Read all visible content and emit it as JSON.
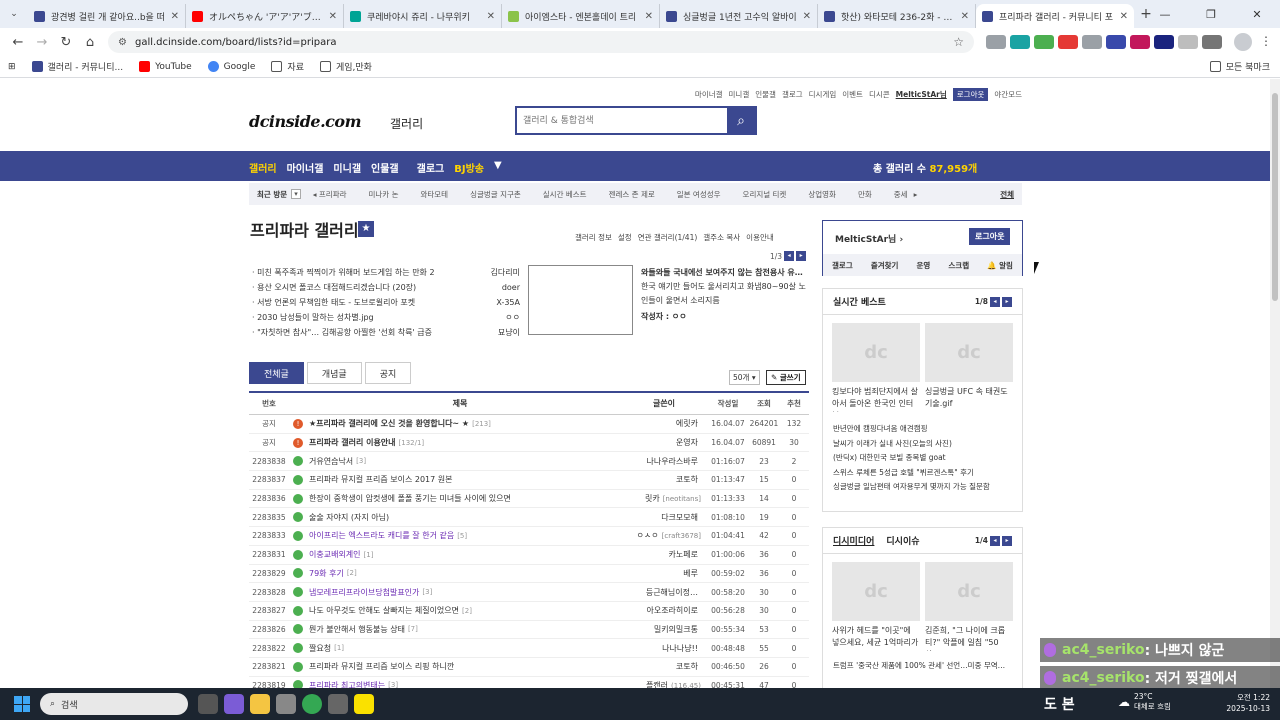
{
  "browser": {
    "tabs": [
      {
        "title": "광견병 걸린 개 같아요..b을 떠",
        "color": "#3b4890",
        "active": false
      },
      {
        "title": "オルペちゃん 'ア'ア'ア'ブロキシ動",
        "color": "#ff0000",
        "active": false
      },
      {
        "title": "쿠레바야시 쥬리 - 나무위키",
        "color": "#00a495",
        "active": false
      },
      {
        "title": "아이엠스타 - 엔본홀데이 트리",
        "color": "#8bc34a",
        "active": false
      },
      {
        "title": "싱글벙글 1년전 고수익 알바이",
        "color": "#3b4890",
        "active": false
      },
      {
        "title": "핫산) 와타모테 236-2화 - 와타",
        "color": "#3b4890",
        "active": false
      },
      {
        "title": "프리파라 갤러리 - 커뮤니티 포",
        "color": "#3b4890",
        "active": true
      }
    ],
    "url": "gall.dcinside.com/board/lists?id=pripara",
    "bookmarks": [
      "갤러리 - 커뮤니티...",
      "YouTube",
      "Google",
      "자료",
      "게임,만화"
    ],
    "bookmarks_right": "모든 북마크"
  },
  "site": {
    "toplinks": [
      "마이너갤",
      "미니갤",
      "인물갤",
      "갤로그",
      "디시게임",
      "이벤트",
      "디시콘"
    ],
    "user": "MelticStAr님",
    "logout": "로그아웃",
    "darkmode": "야간모드",
    "logo": "dcinside.com",
    "logo_sub": "갤러리",
    "search_placeholder": "갤러리 & 통합검색",
    "gnb": [
      "갤러리",
      "마이너갤",
      "미니갤",
      "인물갤",
      "갤로그",
      "BJ방송"
    ],
    "gallery_count_label": "총 갤러리 수",
    "gallery_count": "87,959개",
    "recent_label": "최근 방문",
    "recent": [
      "프리파라",
      "미나카 논",
      "와타모테",
      "싱글벙글 지구촌",
      "실시간 베스트",
      "젠레스 존 제로",
      "일본 여성성우",
      "오리지널 티켓",
      "상업영화",
      "만화",
      "중세"
    ],
    "recent_all": "전체"
  },
  "gallery": {
    "title": "프리파라 갤러리",
    "mark": "★",
    "options": [
      "갤러리 정보",
      "설정",
      "연관 갤러리(1/41)",
      "갤주소 복사",
      "이용안내"
    ],
    "page": "1/3",
    "issues": [
      {
        "title": "미친 폭주족과 찍찍이가 위해머 보드게임 하는 만화 2",
        "author": "김다리미"
      },
      {
        "title": "용산 오시면 폴코스 대접해드리겠습니다 (20장)",
        "author": "doer"
      },
      {
        "title": "서방 언론의 무책임한 태도 - 도브로윌리아 포켓",
        "author": "X-35A"
      },
      {
        "title": "2030 남성들이 말하는 성차별.jpg",
        "author": "ㅇㅇ"
      },
      {
        "title": "\"자칫하면 참사\"… 김해공항 아찔한 '선회 착륙' 급증",
        "author": "묘냥이"
      }
    ],
    "feature": {
      "title": "와들와들 국내에선 보여주지 않는 참전용사 유…",
      "desc": "한국 얘기만 들어도 울서리치고 화냄80~90살 노인들이 울면서 소리지름",
      "writer_label": "작성자 :",
      "writer": "ㅇㅇ"
    },
    "list_tabs": [
      "전체글",
      "개념글",
      "공지"
    ],
    "per_page": "50개 ▾",
    "write": "✎ 글쓰기",
    "columns": [
      "번호",
      "제목",
      "글쓴이",
      "작성일",
      "조회",
      "추천"
    ],
    "rows": [
      {
        "no": "공지",
        "icon": "notice",
        "title": "★프리파라 갤러리에 오신 것을 환영합니다~ ★",
        "comments": "[213]",
        "author": "에릿카",
        "nick": "",
        "date": "16.04.07",
        "views": "264201",
        "recs": "132",
        "style": "bold"
      },
      {
        "no": "공지",
        "icon": "notice",
        "title": "프리파라 갤러리 이용안내",
        "comments": "[132/1]",
        "author": "운영자",
        "nick": "",
        "date": "16.04.07",
        "views": "60891",
        "recs": "30",
        "style": "bold"
      },
      {
        "no": "2283838",
        "icon": "post",
        "title": "거유연습낙서",
        "comments": "[3]",
        "author": "나나우라스바루",
        "nick": "",
        "date": "01:16:07",
        "views": "23",
        "recs": "2",
        "style": ""
      },
      {
        "no": "2283837",
        "icon": "post",
        "title": "프리파라 뮤지컬 프리즘 보이스 2017 원본",
        "comments": "",
        "author": "코토하",
        "nick": "",
        "date": "01:13:47",
        "views": "15",
        "recs": "0",
        "style": ""
      },
      {
        "no": "2283836",
        "icon": "post",
        "title": "한장이 중학생이 압컷생에 폴폴 풍기는 미녀들 사이에 있으면",
        "comments": "",
        "author": "릿카",
        "nick": "[neotitans]",
        "date": "01:13:33",
        "views": "14",
        "recs": "0",
        "style": ""
      },
      {
        "no": "2283835",
        "icon": "post",
        "title": "술술 자야지 (자지 아님)",
        "comments": "",
        "author": "다크모모해",
        "nick": "",
        "date": "01:08:10",
        "views": "19",
        "recs": "0",
        "style": ""
      },
      {
        "no": "2283833",
        "icon": "post",
        "title": "아이프리는 엑스트라도 캐디를 잘 한거 같음",
        "comments": "[5]",
        "author": "ㅇㅅㅇ",
        "nick": "[craft3678]",
        "date": "01:04:41",
        "views": "42",
        "recs": "0",
        "style": "purple"
      },
      {
        "no": "2283831",
        "icon": "post",
        "title": "이충교배외계인",
        "comments": "[1]",
        "author": "카노페로",
        "nick": "",
        "date": "01:00:06",
        "views": "36",
        "recs": "0",
        "style": "purple"
      },
      {
        "no": "2283829",
        "icon": "post",
        "title": "79화 후기",
        "comments": "[2]",
        "author": "베루",
        "nick": "",
        "date": "00:59:02",
        "views": "36",
        "recs": "0",
        "style": "purple"
      },
      {
        "no": "2283828",
        "icon": "post",
        "title": "냄모레프리프라이브당첨발표인가",
        "comments": "[3]",
        "author": "등근해님이정…",
        "nick": "",
        "date": "00:58:20",
        "views": "30",
        "recs": "0",
        "style": "purple"
      },
      {
        "no": "2283827",
        "icon": "post",
        "title": "나도 아무것도 안해도 살빠지는 체질이었으면",
        "comments": "[2]",
        "author": "아오조라히이로",
        "nick": "",
        "date": "00:56:28",
        "views": "30",
        "recs": "0",
        "style": ""
      },
      {
        "no": "2283826",
        "icon": "post",
        "title": "뭔가 불안해서 행동불능 상태",
        "comments": "[7]",
        "author": "밀키의밀크통",
        "nick": "",
        "date": "00:55:34",
        "views": "53",
        "recs": "0",
        "style": ""
      },
      {
        "no": "2283822",
        "icon": "post",
        "title": "짤요청",
        "comments": "[1]",
        "author": "나나나냥!!",
        "nick": "",
        "date": "00:48:48",
        "views": "55",
        "recs": "0",
        "style": ""
      },
      {
        "no": "2283821",
        "icon": "post",
        "title": "프리파라 뮤지컬 프리즘 보이스 리핑 하니깐",
        "comments": "",
        "author": "코토하",
        "nick": "",
        "date": "00:46:50",
        "views": "26",
        "recs": "0",
        "style": ""
      },
      {
        "no": "2283819",
        "icon": "post",
        "title": "프리파라 최고의변태는",
        "comments": "[3]",
        "author": "플캔러",
        "nick": "(116.45)",
        "date": "00:45:31",
        "views": "47",
        "recs": "0",
        "style": "purple"
      }
    ]
  },
  "side": {
    "user": "MelticStAr님",
    "logout": "로그아웃",
    "menu": [
      "갤로그",
      "즐겨찾기",
      "운영",
      "스크랩",
      "🔔 알림"
    ],
    "best_title": "실시간 베스트",
    "best_page": "1/8",
    "best_caps": [
      "킹보다야 범죄단지에서 살아서 돌아온 한국인 인터뷰",
      "싱글벙글 UFC 속 태권도 기술.gif"
    ],
    "best_list": [
      "반년만에 캠핑다녀옴 애견캠핑",
      "날씨가 이래가 실내 사진(오늘의 사진)",
      "(반딕x) 대한민국 보빌 종목별 goat",
      "스위스 루체른 5성급 호텔 \"뷔르겐스톡\" 후기",
      "싱글벙글 일남편태 여자용무게 몇까지 가능 질문함"
    ],
    "media_title": "디시미디어",
    "media_title2": "디시이슈",
    "media_page": "1/4",
    "media_caps": [
      "사위가 헤드를 \"이곳\"에 넣으세요, 세균 1억마리가 …",
      "김준희, \"그 나이에 크롭티?\" 악플에 일침 \"50살…"
    ],
    "media_list": [
      "트럼프 '중국산 제품에 100% 관세' 선언…미중 무역…"
    ]
  },
  "chat": [
    {
      "name": "ac4_seriko",
      "msg": ": 나쁘지 않군"
    },
    {
      "name": "ac4_seriko",
      "msg": ": 저거 찢갤에서"
    }
  ],
  "taskbar": {
    "search": "검색",
    "overlay": "도 본",
    "weather": "23°C",
    "weather_sub": "대체로 흐림",
    "time": "오전 1:22",
    "date": "2025-10-13"
  }
}
